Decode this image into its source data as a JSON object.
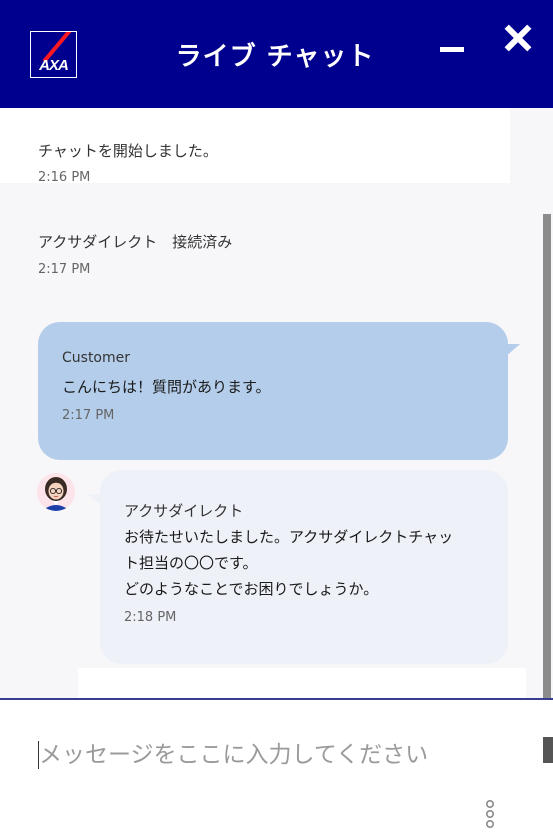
{
  "header": {
    "logo_text": "AXA",
    "title": "ライブ チャット"
  },
  "system_messages": [
    {
      "text": "チャットを開始しました。",
      "time": "2:16 PM"
    },
    {
      "text": "アクサダイレクト　接続済み",
      "time": "2:17 PM"
    }
  ],
  "customer_message": {
    "sender": "Customer",
    "text": "こんにちは！質問があります。",
    "time": "2:17 PM"
  },
  "agent_message": {
    "sender": "アクサダイレクト",
    "lines": [
      "お待たせいたしました。アクサダイレクトチャッ",
      "ト担当の〇〇です。",
      "どのようなことでお困りでしょうか。"
    ],
    "time": "2:18 PM"
  },
  "input": {
    "placeholder": "メッセージをここに入力してください",
    "value": ""
  },
  "icons": {
    "header": [
      "axa-logo-icon",
      "minimize-icon",
      "close-icon"
    ],
    "footer": [
      "more-options-icon"
    ]
  },
  "colors": {
    "header_bg": "#00008f",
    "customer_bubble": "#b4cdea",
    "agent_bubble": "#eef1f7",
    "logo_slash": "#ff1721"
  }
}
